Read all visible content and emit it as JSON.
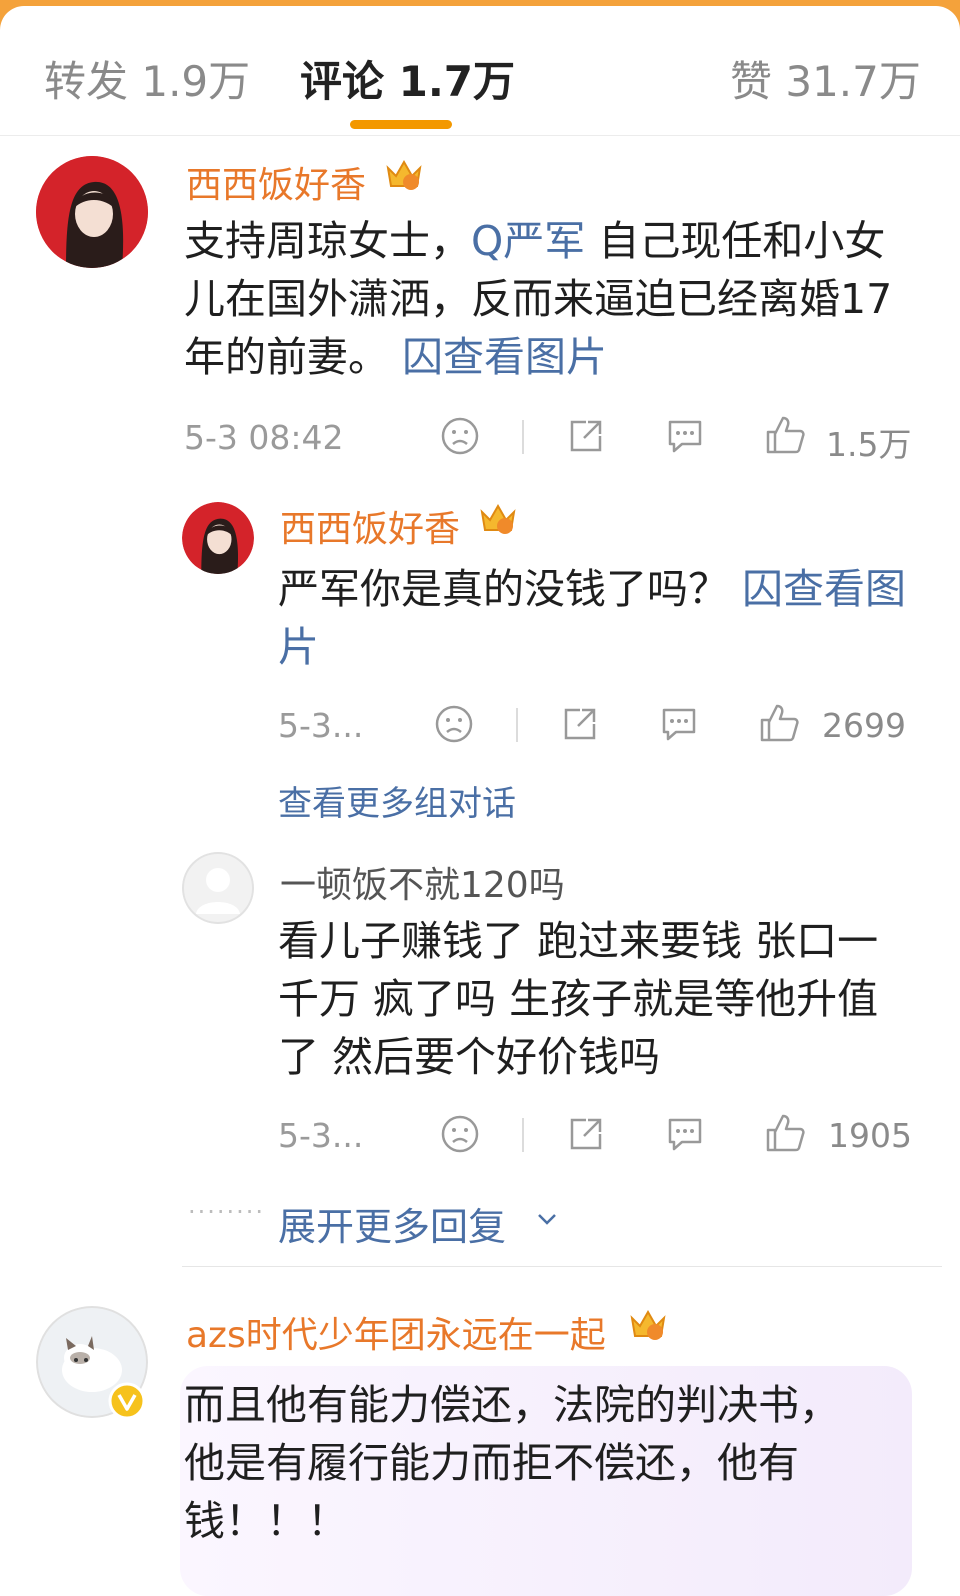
{
  "tabs": {
    "forward": "转发 1.9万",
    "comments": "评论 1.7万",
    "likes": "赞 31.7万"
  },
  "comments": [
    {
      "username": "西西饭好香",
      "text": "支持周琼女士，",
      "mention": "Q严军",
      "text2": " 自己现任和小女儿在国外潇洒，反而来逼迫已经离婚17年的前妻。",
      "image_link": "囚查看图片",
      "time": "5-3 08:42",
      "likes": "1.5万"
    },
    {
      "username": "西西饭好香",
      "text": "严军你是真的没钱了吗？",
      "image_link": "囚查看图片",
      "time": "5-3...",
      "likes": "2699",
      "more_conversation": "查看更多组对话"
    },
    {
      "username": "一顿饭不就120吗",
      "text": "看儿子赚钱了  跑过来要钱  张口一千万  疯了吗  生孩子就是等他升值了  然后要个好价钱吗",
      "time": "5-3...",
      "likes": "1905",
      "expand_more": "展开更多回复"
    },
    {
      "username": "azs时代少年团永远在一起",
      "text": "而且他有能力偿还，法院的判决书，他是有履行能力而拒不偿还，他有钱！！！"
    }
  ],
  "colors": {
    "accent": "#f39800",
    "username": "#e8782a",
    "link": "#4a6fa5"
  },
  "icons": [
    "sad-face-icon",
    "share-icon",
    "comment-icon",
    "like-icon",
    "crown-badge-icon",
    "verified-badge-icon",
    "chevron-down-icon"
  ]
}
